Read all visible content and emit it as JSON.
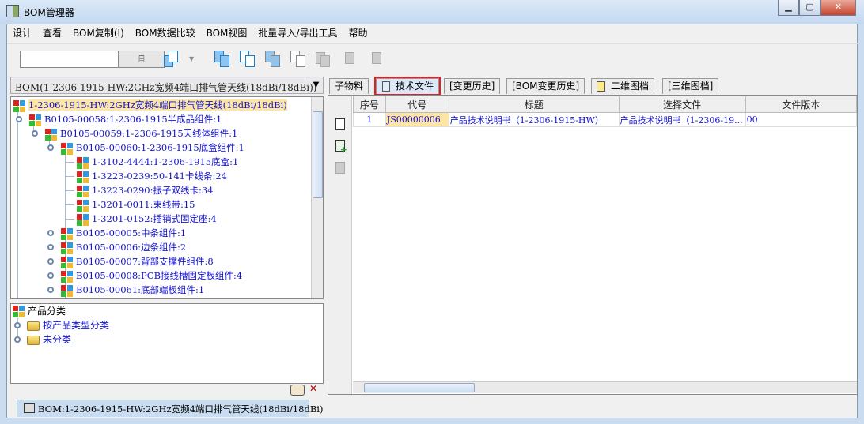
{
  "window": {
    "title": "BOM管理器",
    "min": "▁",
    "max": "▢",
    "close": "✕"
  },
  "menu": [
    "设计",
    "查看",
    "BOM复制(I)",
    "BOM数据比较",
    "BOM视图",
    "批量导入/导出工具",
    "帮助"
  ],
  "toolbar": {
    "search_value": "",
    "search_btn": "⌸",
    "dropdown": "▼"
  },
  "combo": {
    "value": "BOM(1-2306-1915-HW:2GHz宽频4端口排气管天线(18dBi/18dBi))",
    "arrow": "▼"
  },
  "tree": [
    {
      "label": "1-2306-1915-HW:2GHz宽频4端口排气管天线(18dBi/18dBi)",
      "level": 0,
      "selected": true
    },
    {
      "label": "B0105-00058:1-2306-1915半成品组件:1",
      "level": 1
    },
    {
      "label": "B0105-00059:1-2306-1915天线体组件:1",
      "level": 2
    },
    {
      "label": "B0105-00060:1-2306-1915底盒组件:1",
      "level": 3
    },
    {
      "label": "1-3102-4444:1-2306-1915底盒:1",
      "level": 4
    },
    {
      "label": "1-3223-0239:50-141卡线条:24",
      "level": 4
    },
    {
      "label": "1-3223-0290:振子双线卡:34",
      "level": 4
    },
    {
      "label": "1-3201-0011:束线带:15",
      "level": 4
    },
    {
      "label": "1-3201-0152:插销式固定座:4",
      "level": 4
    },
    {
      "label": "B0105-00005:中条组件:1",
      "level": 3
    },
    {
      "label": "B0105-00006:边条组件:2",
      "level": 3
    },
    {
      "label": "B0105-00007:背部支撑件组件:8",
      "level": 3
    },
    {
      "label": "B0105-00008:PCB接线槽固定板组件:4",
      "level": 3
    },
    {
      "label": "B0105-00061:底部端板组件:1",
      "level": 3
    }
  ],
  "category": {
    "root": "产品分类",
    "items": [
      "按产品类型分类",
      "未分类"
    ]
  },
  "bottom_tab": "BOM:1-2306-1915-HW:2GHz宽频4端口排气管天线(18dBi/18dBi)",
  "tabs": [
    "子物料",
    "技术文件",
    "[变更历史]",
    "[BOM变更历史]",
    "二维图档",
    "[三维图档]"
  ],
  "active_tab": "技术文件",
  "grid": {
    "columns": [
      "序号",
      "代号",
      "标题",
      "选择文件",
      "文件版本"
    ],
    "rows": [
      [
        "1",
        "JS00000006",
        "产品技术说明书（1-2306-1915-HW）",
        "产品技术说明书（1-2306-19...",
        "00"
      ]
    ]
  },
  "colors": {
    "selection": "#fde6a4",
    "link": "#1212d0",
    "highlight": "#e02020"
  }
}
